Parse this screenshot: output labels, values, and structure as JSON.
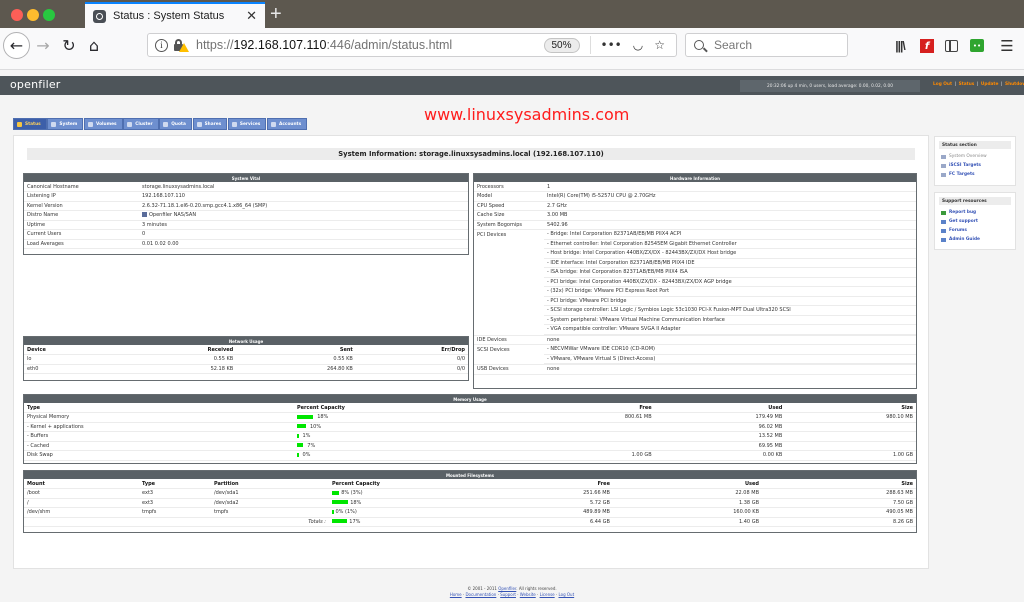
{
  "browser": {
    "tab_title": "Status : System Status",
    "url_scheme": "https://",
    "url_host": "192.168.107.110",
    "url_rest": ":446/admin/status.html",
    "zoom": "50%",
    "search_placeholder": "Search",
    "flash_glyph": "f"
  },
  "header": {
    "logo": "openfiler",
    "uptime": "20:32:06 up 4 min, 0 users, load average: 0.00, 0.02, 0.00",
    "links": [
      "Log Out",
      "Status",
      "Update",
      "Shutdown"
    ]
  },
  "watermark": "www.linuxsysadmins.com",
  "nav_tabs": [
    {
      "label": "Status",
      "active": true
    },
    {
      "label": "System"
    },
    {
      "label": "Volumes"
    },
    {
      "label": "Cluster"
    },
    {
      "label": "Quota"
    },
    {
      "label": "Shares"
    },
    {
      "label": "Services"
    },
    {
      "label": "Accounts"
    }
  ],
  "system_info_title": "System Information: storage.linuxsysadmins.local (192.168.107.110)",
  "system_vital": {
    "title": "System Vital",
    "rows": [
      {
        "k": "Canonical Hostname",
        "v": "storage.linuxsysadmins.local"
      },
      {
        "k": "Listening IP",
        "v": "192.168.107.110"
      },
      {
        "k": "Kernel Version",
        "v": "2.6.32-71.18.1.el6-0.20.smp.gcc4.1.x86_64 (SMP)"
      },
      {
        "k": "Distro Name",
        "v": "Openfiler NAS/SAN"
      },
      {
        "k": "Uptime",
        "v": "3 minutes"
      },
      {
        "k": "Current Users",
        "v": "0"
      },
      {
        "k": "Load Averages",
        "v": "0.01 0.02 0.00"
      }
    ]
  },
  "network_usage": {
    "title": "Network Usage",
    "headers": [
      "Device",
      "Received",
      "Sent",
      "Err/Drop"
    ],
    "rows": [
      [
        "lo",
        "0.55 KB",
        "0.55 KB",
        "0/0"
      ],
      [
        "eth0",
        "52.18 KB",
        "264.80 KB",
        "0/0"
      ]
    ]
  },
  "hardware": {
    "title": "Hardware Information",
    "rows": [
      {
        "k": "Processors",
        "v": "1"
      },
      {
        "k": "Model",
        "v": "Intel(R) Core(TM) i5-5257U CPU @ 2.70GHz"
      },
      {
        "k": "CPU Speed",
        "v": "2.7 GHz"
      },
      {
        "k": "Cache Size",
        "v": "3.00 MB"
      },
      {
        "k": "System Bogomips",
        "v": "5402.96"
      }
    ],
    "pci_label": "PCI Devices",
    "pci": [
      "- Bridge: Intel Corporation 82371AB/EB/MB PIIX4 ACPI",
      "- Ethernet controller: Intel Corporation 82545EM Gigabit Ethernet Controller",
      "- Host bridge: Intel Corporation 440BX/ZX/DX - 82443BX/ZX/DX Host bridge",
      "- IDE interface: Intel Corporation 82371AB/EB/MB PIIX4 IDE",
      "- ISA bridge: Intel Corporation 82371AB/EB/MB PIIX4 ISA",
      "- PCI bridge: Intel Corporation 440BX/ZX/DX - 82443BX/ZX/DX AGP bridge",
      "- (32x) PCI bridge: VMware PCI Express Root Port",
      "- PCI bridge: VMware PCI bridge",
      "- SCSI storage controller: LSI Logic / Symbios Logic 53c1030 PCI-X Fusion-MPT Dual Ultra320 SCSI",
      "- System peripheral: VMware Virtual Machine Communication Interface",
      "- VGA compatible controller: VMware SVGA II Adapter"
    ],
    "ide_label": "IDE Devices",
    "ide_value": "none",
    "scsi_label": "SCSI Devices",
    "scsi": [
      "- NECVMWar VMware IDE CDR10 (CD-ROM)",
      "- VMware, VMware Virtual S (Direct-Access)"
    ],
    "usb_label": "USB Devices",
    "usb_value": "none"
  },
  "memory": {
    "title": "Memory Usage",
    "headers": [
      "Type",
      "Percent Capacity",
      "Free",
      "Used",
      "Size"
    ],
    "rows": [
      {
        "type": "Physical Memory",
        "pct": 18,
        "pct_label": "18%",
        "free": "800.61 MB",
        "used": "179.49 MB",
        "size": "980.10 MB"
      },
      {
        "type": "- Kernel + applications",
        "pct": 10,
        "pct_label": "10%",
        "free": "",
        "used": "96.02 MB",
        "size": ""
      },
      {
        "type": "- Buffers",
        "pct": 1,
        "pct_label": "1%",
        "free": "",
        "used": "13.52 MB",
        "size": ""
      },
      {
        "type": "- Cached",
        "pct": 7,
        "pct_label": "7%",
        "free": "",
        "used": "69.95 MB",
        "size": ""
      },
      {
        "type": "Disk Swap",
        "pct": 0,
        "pct_label": "0%",
        "free": "1.00 GB",
        "used": "0.00 KB",
        "size": "1.00 GB"
      }
    ]
  },
  "filesystems": {
    "title": "Mounted Filesystems",
    "headers": [
      "Mount",
      "Type",
      "Partition",
      "Percent Capacity",
      "Free",
      "Used",
      "Size"
    ],
    "rows": [
      {
        "mount": "/boot",
        "type": "ext3",
        "partition": "/dev/sda1",
        "pct": 8,
        "pct_label": "8% (3%)",
        "free": "251.66 MB",
        "used": "22.08 MB",
        "size": "288.63 MB"
      },
      {
        "mount": "/",
        "type": "ext3",
        "partition": "/dev/sda2",
        "pct": 18,
        "pct_label": "18%",
        "free": "5.72 GB",
        "used": "1.38 GB",
        "size": "7.50 GB"
      },
      {
        "mount": "/dev/shm",
        "type": "tmpfs",
        "partition": "tmpfs",
        "pct": 0,
        "pct_label": "0% (1%)",
        "free": "489.89 MB",
        "used": "160.00 KB",
        "size": "490.05 MB"
      }
    ],
    "totals_label": "Totals :",
    "totals": {
      "pct": 17,
      "pct_label": "17%",
      "free": "6.44 GB",
      "used": "1.40 GB",
      "size": "8.26 GB"
    }
  },
  "sidebar": {
    "status_title": "Status section",
    "status_links": [
      {
        "label": "System Overview",
        "active": false
      },
      {
        "label": "iSCSI Targets",
        "active": true
      },
      {
        "label": "FC Targets",
        "active": true
      }
    ],
    "support_title": "Support resources",
    "support_links": [
      "Report bug",
      "Get support",
      "Forums",
      "Admin Guide"
    ]
  },
  "footer": {
    "copyright_pre": "© 2001 - 2011 ",
    "copyright_link": "Openfiler",
    "copyright_post": ". All rights reserved.",
    "links": [
      "Home",
      "Documentation",
      "Support",
      "Website",
      "License",
      "Log Out"
    ]
  }
}
